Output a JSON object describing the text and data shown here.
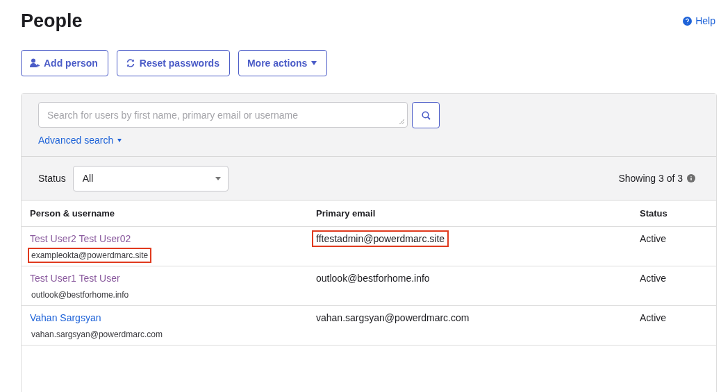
{
  "page": {
    "title": "People",
    "help": "Help"
  },
  "actions": [
    {
      "label": "Add person",
      "kind": "add"
    },
    {
      "label": "Reset passwords",
      "kind": "reset"
    },
    {
      "label": "More actions",
      "kind": "menu"
    }
  ],
  "search": {
    "placeholder": "Search for users by first name, primary email or username",
    "advanced": "Advanced search"
  },
  "filter": {
    "label": "Status",
    "value": "All",
    "count": "Showing 3 of 3"
  },
  "table": {
    "columns": [
      "Person & username",
      "Primary email",
      "Status"
    ],
    "rows": [
      {
        "name": "Test User2 Test User02",
        "username": "exampleokta@powerdmarc.site",
        "email": "fftestadmin@powerdmarc.site",
        "status": "Active",
        "visited": true,
        "username_flagged": true,
        "email_flagged": true
      },
      {
        "name": "Test User1 Test User",
        "username": "outlook@bestforhome.info",
        "email": "outlook@bestforhome.info",
        "status": "Active",
        "visited": true,
        "username_flagged": false,
        "email_flagged": false
      },
      {
        "name": "Vahan Sargsyan",
        "username": "vahan.sargsyan@powerdmarc.com",
        "email": "vahan.sargsyan@powerdmarc.com",
        "status": "Active",
        "visited": false,
        "username_flagged": false,
        "email_flagged": false
      }
    ]
  }
}
